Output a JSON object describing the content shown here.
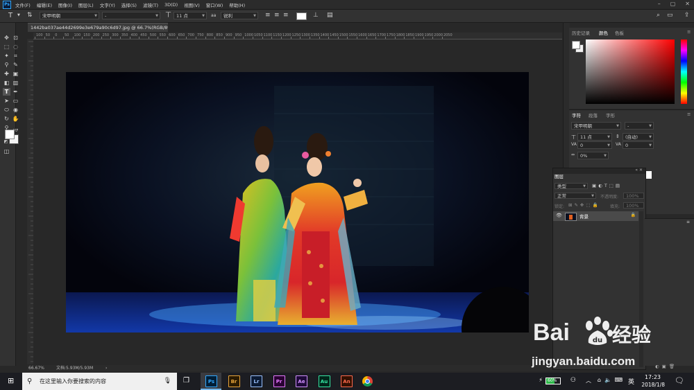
{
  "menubar": {
    "logo": "Ps",
    "items": [
      "文件(F)",
      "编辑(E)",
      "图像(I)",
      "图层(L)",
      "文字(Y)",
      "选择(S)",
      "滤镜(T)",
      "3D(D)",
      "视图(V)",
      "窗口(W)",
      "帮助(H)"
    ]
  },
  "options": {
    "tool_glyph": "T",
    "font_family": "宋甲明朝",
    "font_style": "-",
    "font_size": "11 点",
    "aa_label": "aa",
    "antialias": "锐利",
    "text_color": "#ffffff"
  },
  "document": {
    "tab_title": "1442ba037ae44d2699e3e679a90c6d97.jpg @ 66.7%(RGB/8*) *",
    "close_glyph": "×",
    "ruler_marks": [
      "100",
      "50",
      "0",
      "50",
      "100",
      "150",
      "200",
      "250",
      "300",
      "350",
      "400",
      "450",
      "500",
      "550",
      "600",
      "650",
      "700",
      "750",
      "800",
      "850",
      "900",
      "950",
      "1000",
      "1050",
      "1100",
      "1150",
      "1200",
      "1250",
      "1300",
      "1350",
      "1400",
      "1450",
      "1500",
      "1550",
      "1600",
      "1650",
      "1700",
      "1750",
      "1800",
      "1850",
      "1900",
      "1950",
      "2000",
      "2050"
    ],
    "zoom": "66.67%",
    "doc_info": "文档:5.93M/5.93M"
  },
  "panels": {
    "color_tabs": [
      "历史记录",
      "颜色",
      "色板"
    ],
    "char_tabs": [
      "字符",
      "段落",
      "字形"
    ],
    "char": {
      "font_family": "宋甲明朝",
      "font_style": "-",
      "size": "11 点",
      "leading": "(自动)",
      "kerning": "0",
      "tracking": "0",
      "scale": "0%"
    },
    "layers": {
      "title": "图层",
      "kind_filter": "类型",
      "blend_mode": "正常",
      "opacity_label": "不透明度:",
      "opacity_value": "100%",
      "lock_label": "锁定:",
      "fill_label": "填充:",
      "fill_value": "100%",
      "layer_name": "背景"
    }
  },
  "taskbar": {
    "search_placeholder": "在这里输入你要搜索的内容",
    "apps": [
      {
        "label": "Ps",
        "color": "#31a8ff",
        "bg": "#001e36"
      },
      {
        "label": "Br",
        "color": "#e8a43a",
        "bg": "#2a1a00"
      },
      {
        "label": "Lr",
        "color": "#9bc2ff",
        "bg": "#0b1a33"
      },
      {
        "label": "Pr",
        "color": "#e77bff",
        "bg": "#2a0033"
      },
      {
        "label": "Ae",
        "color": "#d291ff",
        "bg": "#1f0a3a"
      },
      {
        "label": "Au",
        "color": "#35e8a3",
        "bg": "#00261a"
      },
      {
        "label": "An",
        "color": "#ff6a4d",
        "bg": "#331000"
      }
    ],
    "battery": "60%",
    "ime": "英",
    "time": "17:23",
    "date": "2018/1/8"
  },
  "watermark": {
    "brand": "Bai",
    "brand2": "经验",
    "url": "jingyan.baidu.com"
  }
}
